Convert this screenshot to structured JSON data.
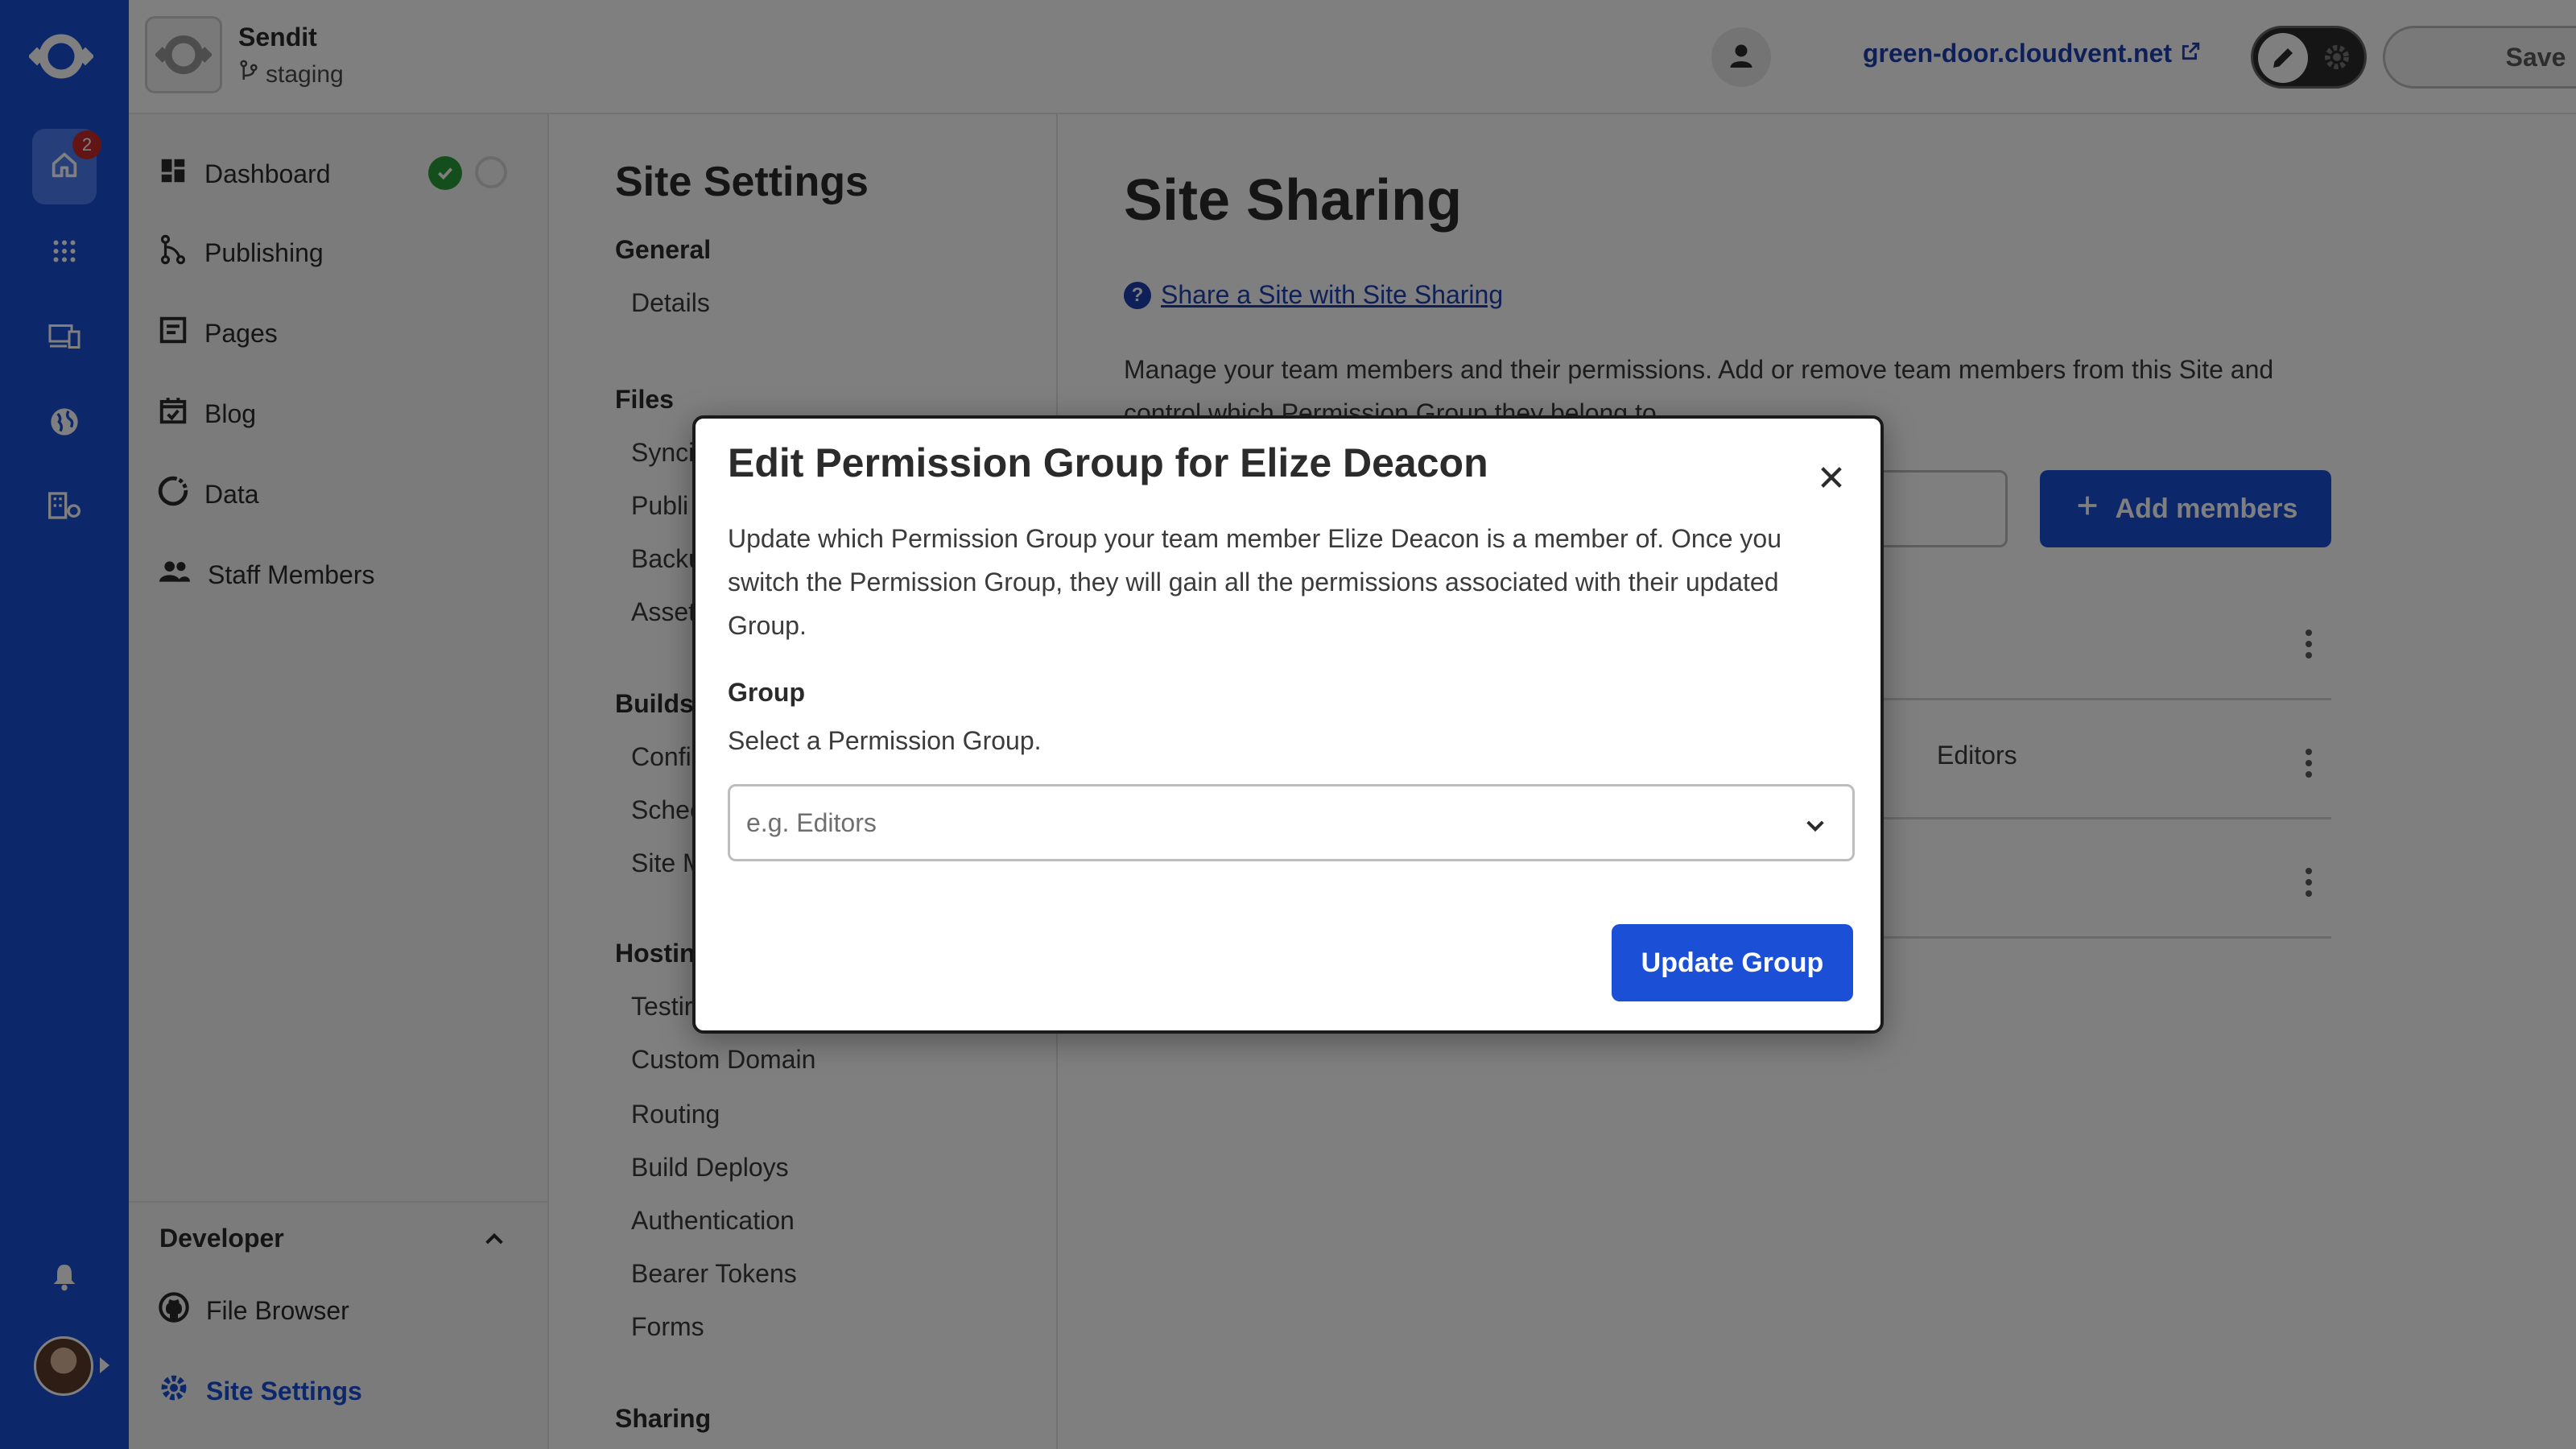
{
  "topbar": {
    "site_name": "Sendit",
    "branch": "staging",
    "domain": "green-door.cloudvent.net",
    "save_label": "Save"
  },
  "rail": {
    "badge_count": "2",
    "icons": [
      "app-logo-icon",
      "home-icon",
      "apps-grid-icon",
      "devices-icon",
      "globe-icon",
      "organization-icon",
      "bell-icon"
    ]
  },
  "nav": {
    "items": [
      {
        "label": "Dashboard",
        "icon": "dashboard-icon"
      },
      {
        "label": "Publishing",
        "icon": "branch-icon"
      },
      {
        "label": "Pages",
        "icon": "page-icon"
      },
      {
        "label": "Blog",
        "icon": "calendar-check-icon"
      },
      {
        "label": "Data",
        "icon": "data-icon"
      },
      {
        "label": "Staff Members",
        "icon": "people-icon"
      }
    ],
    "developer": {
      "title": "Developer",
      "items": [
        {
          "label": "File Browser",
          "icon": "github-icon"
        },
        {
          "label": "Site Settings",
          "icon": "gear-icon",
          "active": true
        }
      ]
    }
  },
  "settings_nav": {
    "title": "Site Settings",
    "sections": [
      {
        "heading": "General",
        "links": [
          "Details"
        ]
      },
      {
        "heading": "Files",
        "links": [
          "Synci",
          "Publi",
          "Backu",
          "Asset"
        ]
      },
      {
        "heading": "Builds",
        "links": [
          "Confi",
          "Schec",
          "Site M"
        ]
      },
      {
        "heading": "Hostin",
        "links": [
          "Testir",
          "Custom Domain",
          "Routing",
          "Build Deploys",
          "Authentication",
          "Bearer Tokens",
          "Forms"
        ]
      },
      {
        "heading": "Sharing",
        "links": []
      }
    ]
  },
  "main": {
    "title": "Site Sharing",
    "help_link": "Share a Site with Site Sharing",
    "description": "Manage your team members and their permissions. Add or remove team members from this Site and control which Permission Group they belong to.",
    "add_members_label": "Add members",
    "rows": [
      {
        "group": ""
      },
      {
        "group": "Editors"
      },
      {
        "group": ""
      }
    ]
  },
  "modal": {
    "title": "Edit Permission Group for Elize Deacon",
    "body": "Update which Permission Group your team member Elize Deacon is a member of. Once you switch the Permission Group, they will gain all the permissions associated with their updated Group.",
    "field_label": "Group",
    "field_hint": "Select a Permission Group.",
    "select_placeholder": "e.g. Editors",
    "submit_label": "Update Group"
  },
  "colors": {
    "brand_blue": "#1a4fd6",
    "link_blue": "#1e3faf",
    "status_green": "#2a9d3b",
    "badge_red": "#c62a2a"
  }
}
